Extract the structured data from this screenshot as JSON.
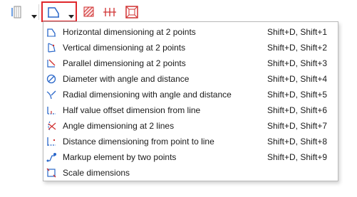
{
  "toolbar": {
    "buttons": [
      {
        "name": "panel-icon"
      },
      {
        "name": "dimension-line-icon",
        "active": true
      },
      {
        "name": "hatch-dimension-icon"
      },
      {
        "name": "linear-dimension-icon"
      },
      {
        "name": "frame-dimension-icon"
      }
    ],
    "active_color": "#e0262b"
  },
  "menu": {
    "items": [
      {
        "label": "Horizontal dimensioning at 2 points",
        "shortcut": "Shift+D, Shift+1",
        "icon": "horizontal-dimension-icon"
      },
      {
        "label": "Vertical dimensioning at 2 points",
        "shortcut": "Shift+D, Shift+2",
        "icon": "vertical-dimension-icon"
      },
      {
        "label": "Parallel dimensioning at 2 points",
        "shortcut": "Shift+D, Shift+3",
        "icon": "parallel-dimension-icon"
      },
      {
        "label": "Diameter with angle and distance",
        "shortcut": "Shift+D, Shift+4",
        "icon": "diameter-icon"
      },
      {
        "label": "Radial dimensioning with angle and distance",
        "shortcut": "Shift+D, Shift+5",
        "icon": "radial-dimension-icon"
      },
      {
        "label": "Half value offset dimension from line",
        "shortcut": "Shift+D, Shift+6",
        "icon": "half-offset-icon"
      },
      {
        "label": "Angle dimensioning at 2 lines",
        "shortcut": "Shift+D, Shift+7",
        "icon": "angle-dimension-icon"
      },
      {
        "label": "Distance dimensioning from point to line",
        "shortcut": "Shift+D, Shift+8",
        "icon": "distance-dimension-icon"
      },
      {
        "label": "Markup element by two points",
        "shortcut": "Shift+D, Shift+9",
        "icon": "markup-element-icon"
      },
      {
        "label": "Scale dimensions",
        "shortcut": "",
        "icon": "scale-dimensions-icon"
      }
    ]
  }
}
